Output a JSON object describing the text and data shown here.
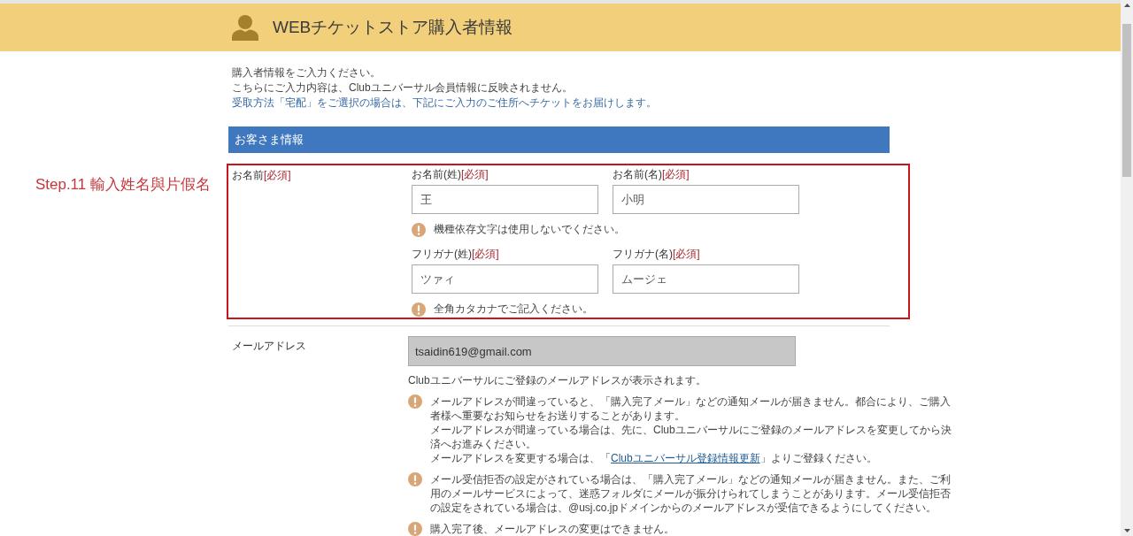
{
  "header": {
    "title": "WEBチケットストア購入者情報"
  },
  "intro": [
    {
      "text": "購入者情報をご入力ください。",
      "highlighted": false
    },
    {
      "text": "こちらにご入力内容は、Clubユニバーサル会員情報に反映されません。",
      "highlighted": false
    },
    {
      "text": "受取方法「宅配」をご選択の場合は、下記にご入力のご住所へチケットをお届けします。",
      "highlighted": true
    }
  ],
  "section": {
    "title": "お客さま情報"
  },
  "annotation": {
    "text": "Step.11 輸入姓名與片假名"
  },
  "name_row": {
    "label": "お名前",
    "required_label": "[必須]",
    "highlighted": true,
    "groups": [
      {
        "fields": [
          {
            "label": "お名前(姓)",
            "required_label": "[必須]",
            "value": "王"
          },
          {
            "label": "お名前(名)",
            "required_label": "[必須]",
            "value": "小明"
          }
        ],
        "note": "機種依存文字は使用しないでください。"
      },
      {
        "fields": [
          {
            "label": "フリガナ(姓)",
            "required_label": "[必須]",
            "value": "ツァィ"
          },
          {
            "label": "フリガナ(名)",
            "required_label": "[必須]",
            "value": "ムージェ"
          }
        ],
        "note": "全角カタカナでご記入ください。"
      }
    ]
  },
  "email_row": {
    "label": "メールアドレス",
    "value": "tsaidin619@gmail.com",
    "disabled": true,
    "hint": "Clubユニバーサルにご登録のメールアドレスが表示されます。",
    "notes": [
      {
        "paragraphs": [
          [
            {
              "kind": "text",
              "text": "メールアドレスが間違っていると、「購入完了メール」などの通知メールが届きません。都合により、ご購入者様へ重要なお知らせをお送りすることがあります。"
            }
          ],
          [
            {
              "kind": "text",
              "text": "メールアドレスが間違っている場合は、先に、Clubユニバーサルにご登録のメールアドレスを変更してから決済へお進みください。"
            }
          ],
          [
            {
              "kind": "text",
              "text": "メールアドレスを変更する場合は、「"
            },
            {
              "kind": "link",
              "text": "Clubユニバーサル登録情報更新"
            },
            {
              "kind": "text",
              "text": "」よりご登録ください。"
            }
          ]
        ]
      },
      {
        "paragraphs": [
          [
            {
              "kind": "text",
              "text": "メール受信拒否の設定がされている場合は、「購入完了メール」などの通知メールが届きません。また、ご利用のメールサービスによって、迷惑フォルダにメールが振分けられてしまうことがあります。メール受信拒否の設定をされている場合は、@usj.co.jpドメインからのメールアドレスが受信できるようにしてください。"
            }
          ]
        ]
      },
      {
        "paragraphs": [
          [
            {
              "kind": "text",
              "text": "購入完了後、メールアドレスの変更はできません。"
            }
          ]
        ]
      }
    ]
  }
}
